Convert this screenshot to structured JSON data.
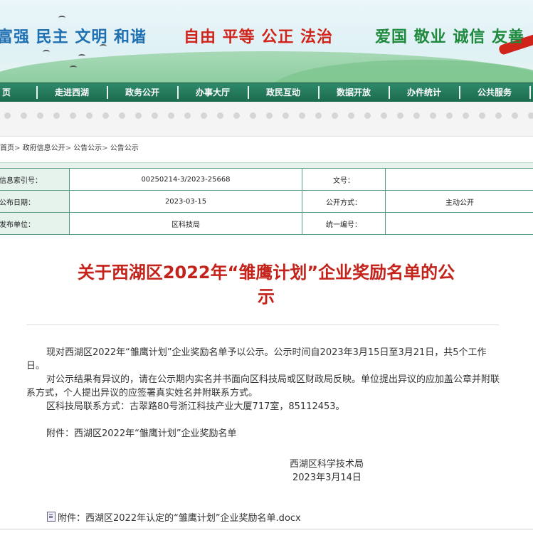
{
  "banner": {
    "slogan_left": "富强 民主 文明 和谐",
    "slogan_middle": "自由 平等 公正 法治",
    "slogan_right": "爱国 敬业 诚信 友善"
  },
  "nav": {
    "items": [
      "页",
      "走进西湖",
      "政务公开",
      "办事大厅",
      "政民互动",
      "数据开放",
      "办件统计",
      "公共服务"
    ]
  },
  "breadcrumb": {
    "items": [
      "首页",
      "政府信息公开",
      "公告公示",
      "公告公示"
    ],
    "separator": ">"
  },
  "info": {
    "index_label": "信息索引号：",
    "index_value": "00250214-3/2023-25668",
    "doc_no_label": "文号：",
    "doc_no_value": "",
    "date_label": "公布日期：",
    "date_value": "2023-03-15",
    "open_mode_label": "公开方式：",
    "open_mode_value": "主动公开",
    "publisher_label": "发布单位：",
    "publisher_value": "区科技局",
    "unified_no_label": "统一编号：",
    "unified_no_value": ""
  },
  "article": {
    "title_line1": "关于西湖区2022年“雏鹰计划”企业奖励名单的公",
    "title_line2": "示",
    "para1": "现对西湖区2022年“雏鹰计划”企业奖励名单予以公示。公示时间自2023年3月15日至3月21日，共5个工作日。",
    "para2": "对公示结果有异议的，请在公示期内实名并书面向区科技局或区财政局反映。单位提出异议的应加盖公章并附联系方式，个人提出异议的应签署真实姓名并附联系方式。",
    "para3": "区科技局联系方式：古翠路80号浙江科技产业大厦717室，85112453。",
    "attachment_note": "附件：西湖区2022年“雏鹰计划”企业奖励名单",
    "signature_org": "西湖区科学技术局",
    "signature_date": "2023年3月14日",
    "attachment_link": "附件：西湖区2022年认定的“雏鹰计划”企业奖励名单.docx"
  },
  "colors": {
    "nav_green": "#1c6a4d",
    "title_red": "#c3231a",
    "table_border": "#5a9b80",
    "label_bg": "#e6f2ec"
  }
}
